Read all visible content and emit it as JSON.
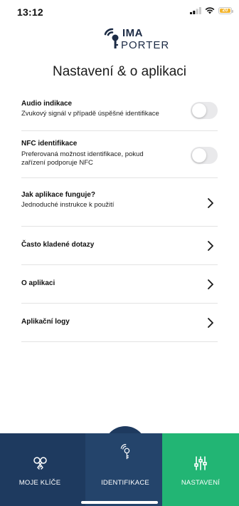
{
  "status_bar": {
    "time": "13:12",
    "battery": "20",
    "battery_color": "#f3b52e"
  },
  "logo": {
    "line1": "IMA",
    "line2": "PORTER"
  },
  "page_title": "Nastavení & o aplikaci",
  "settings": {
    "audio": {
      "title": "Audio indikace",
      "subtitle": "Zvukový signál v případě úspěšné identifikace",
      "enabled": false
    },
    "nfc": {
      "title": "NFC identifikace",
      "subtitle_line1": "Preferovaná možnost identifikace, pokud",
      "subtitle_line2": "zařízení podporuje NFC",
      "enabled": false
    },
    "how": {
      "title": "Jak aplikace funguje?",
      "subtitle": "Jednoduché instrukce k použití"
    },
    "faq": {
      "title": "Často kladené dotazy"
    },
    "about": {
      "title": "O aplikaci"
    },
    "logs": {
      "title": "Aplikační logy"
    }
  },
  "nav": {
    "moje": {
      "label": "MOJE KLÍČE",
      "icon": "keys-icon"
    },
    "ident": {
      "label": "IDENTIFIKACE",
      "icon": "key-nfc-icon"
    },
    "nast": {
      "label": "NASTAVENÍ",
      "icon": "sliders-icon",
      "active": true
    }
  },
  "colors": {
    "nav": "#1e3a5f",
    "active": "#22b574",
    "brand": "#1c2b45"
  }
}
